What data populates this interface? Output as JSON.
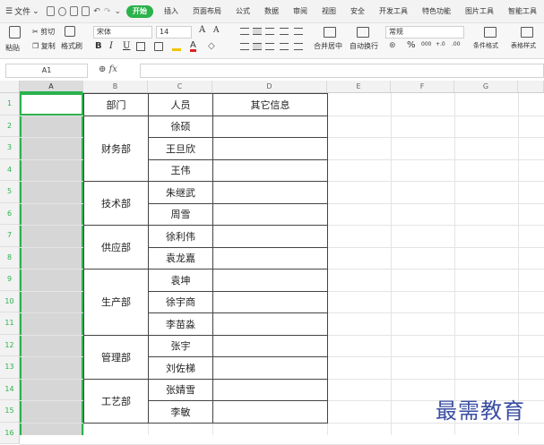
{
  "menubar": {
    "file_label": "文件",
    "tabs": [
      {
        "label": "开始",
        "active": true
      },
      {
        "label": "插入",
        "active": false
      },
      {
        "label": "页面布局",
        "active": false
      },
      {
        "label": "公式",
        "active": false
      },
      {
        "label": "数据",
        "active": false
      },
      {
        "label": "审阅",
        "active": false
      },
      {
        "label": "视图",
        "active": false
      },
      {
        "label": "安全",
        "active": false
      },
      {
        "label": "开发工具",
        "active": false
      },
      {
        "label": "特色功能",
        "active": false
      },
      {
        "label": "图片工具",
        "active": false
      },
      {
        "label": "智能工具",
        "active": false
      }
    ],
    "accent_color": "#2bb24c"
  },
  "ribbon": {
    "cut_label": "剪切",
    "paste_label": "粘贴",
    "copy_label": "复制",
    "format_painter_label": "格式刷",
    "font_name": "宋体",
    "font_size": "14",
    "bold": "B",
    "italic": "I",
    "underline": "U",
    "grow_font": "A",
    "shrink_font": "A",
    "merge_center_label": "合并居中",
    "auto_wrap_label": "自动换行",
    "number_format": "常规",
    "percent": "%",
    "thousands": "000",
    "inc_decimal": "+.0",
    "dec_decimal": ".00",
    "conditional_format_label": "条件格式",
    "table_style_label": "表格样式"
  },
  "formula": {
    "name_box": "A1",
    "fx_label": "fx",
    "value": ""
  },
  "columns": [
    "A",
    "B",
    "C",
    "D",
    "E",
    "F",
    "G"
  ],
  "rows": [
    "1",
    "2",
    "3",
    "4",
    "5",
    "6",
    "7",
    "8",
    "9",
    "10",
    "11",
    "12",
    "13",
    "14",
    "15",
    "16"
  ],
  "table": {
    "headers": {
      "dept": "部门",
      "person": "人员",
      "other": "其它信息"
    },
    "groups": [
      {
        "dept": "财务部",
        "people": [
          "徐硕",
          "王旦欣",
          "王伟"
        ]
      },
      {
        "dept": "技术部",
        "people": [
          "朱继武",
          "周雪"
        ]
      },
      {
        "dept": "供应部",
        "people": [
          "徐利伟",
          "袁龙嘉"
        ]
      },
      {
        "dept": "生产部",
        "people": [
          "袁坤",
          "徐宇商",
          "李苗淼"
        ]
      },
      {
        "dept": "管理部",
        "people": [
          "张宇",
          "刘佐梯"
        ]
      },
      {
        "dept": "工艺部",
        "people": [
          "张婧雪",
          "李敏"
        ]
      }
    ]
  },
  "watermark": "最需教育"
}
